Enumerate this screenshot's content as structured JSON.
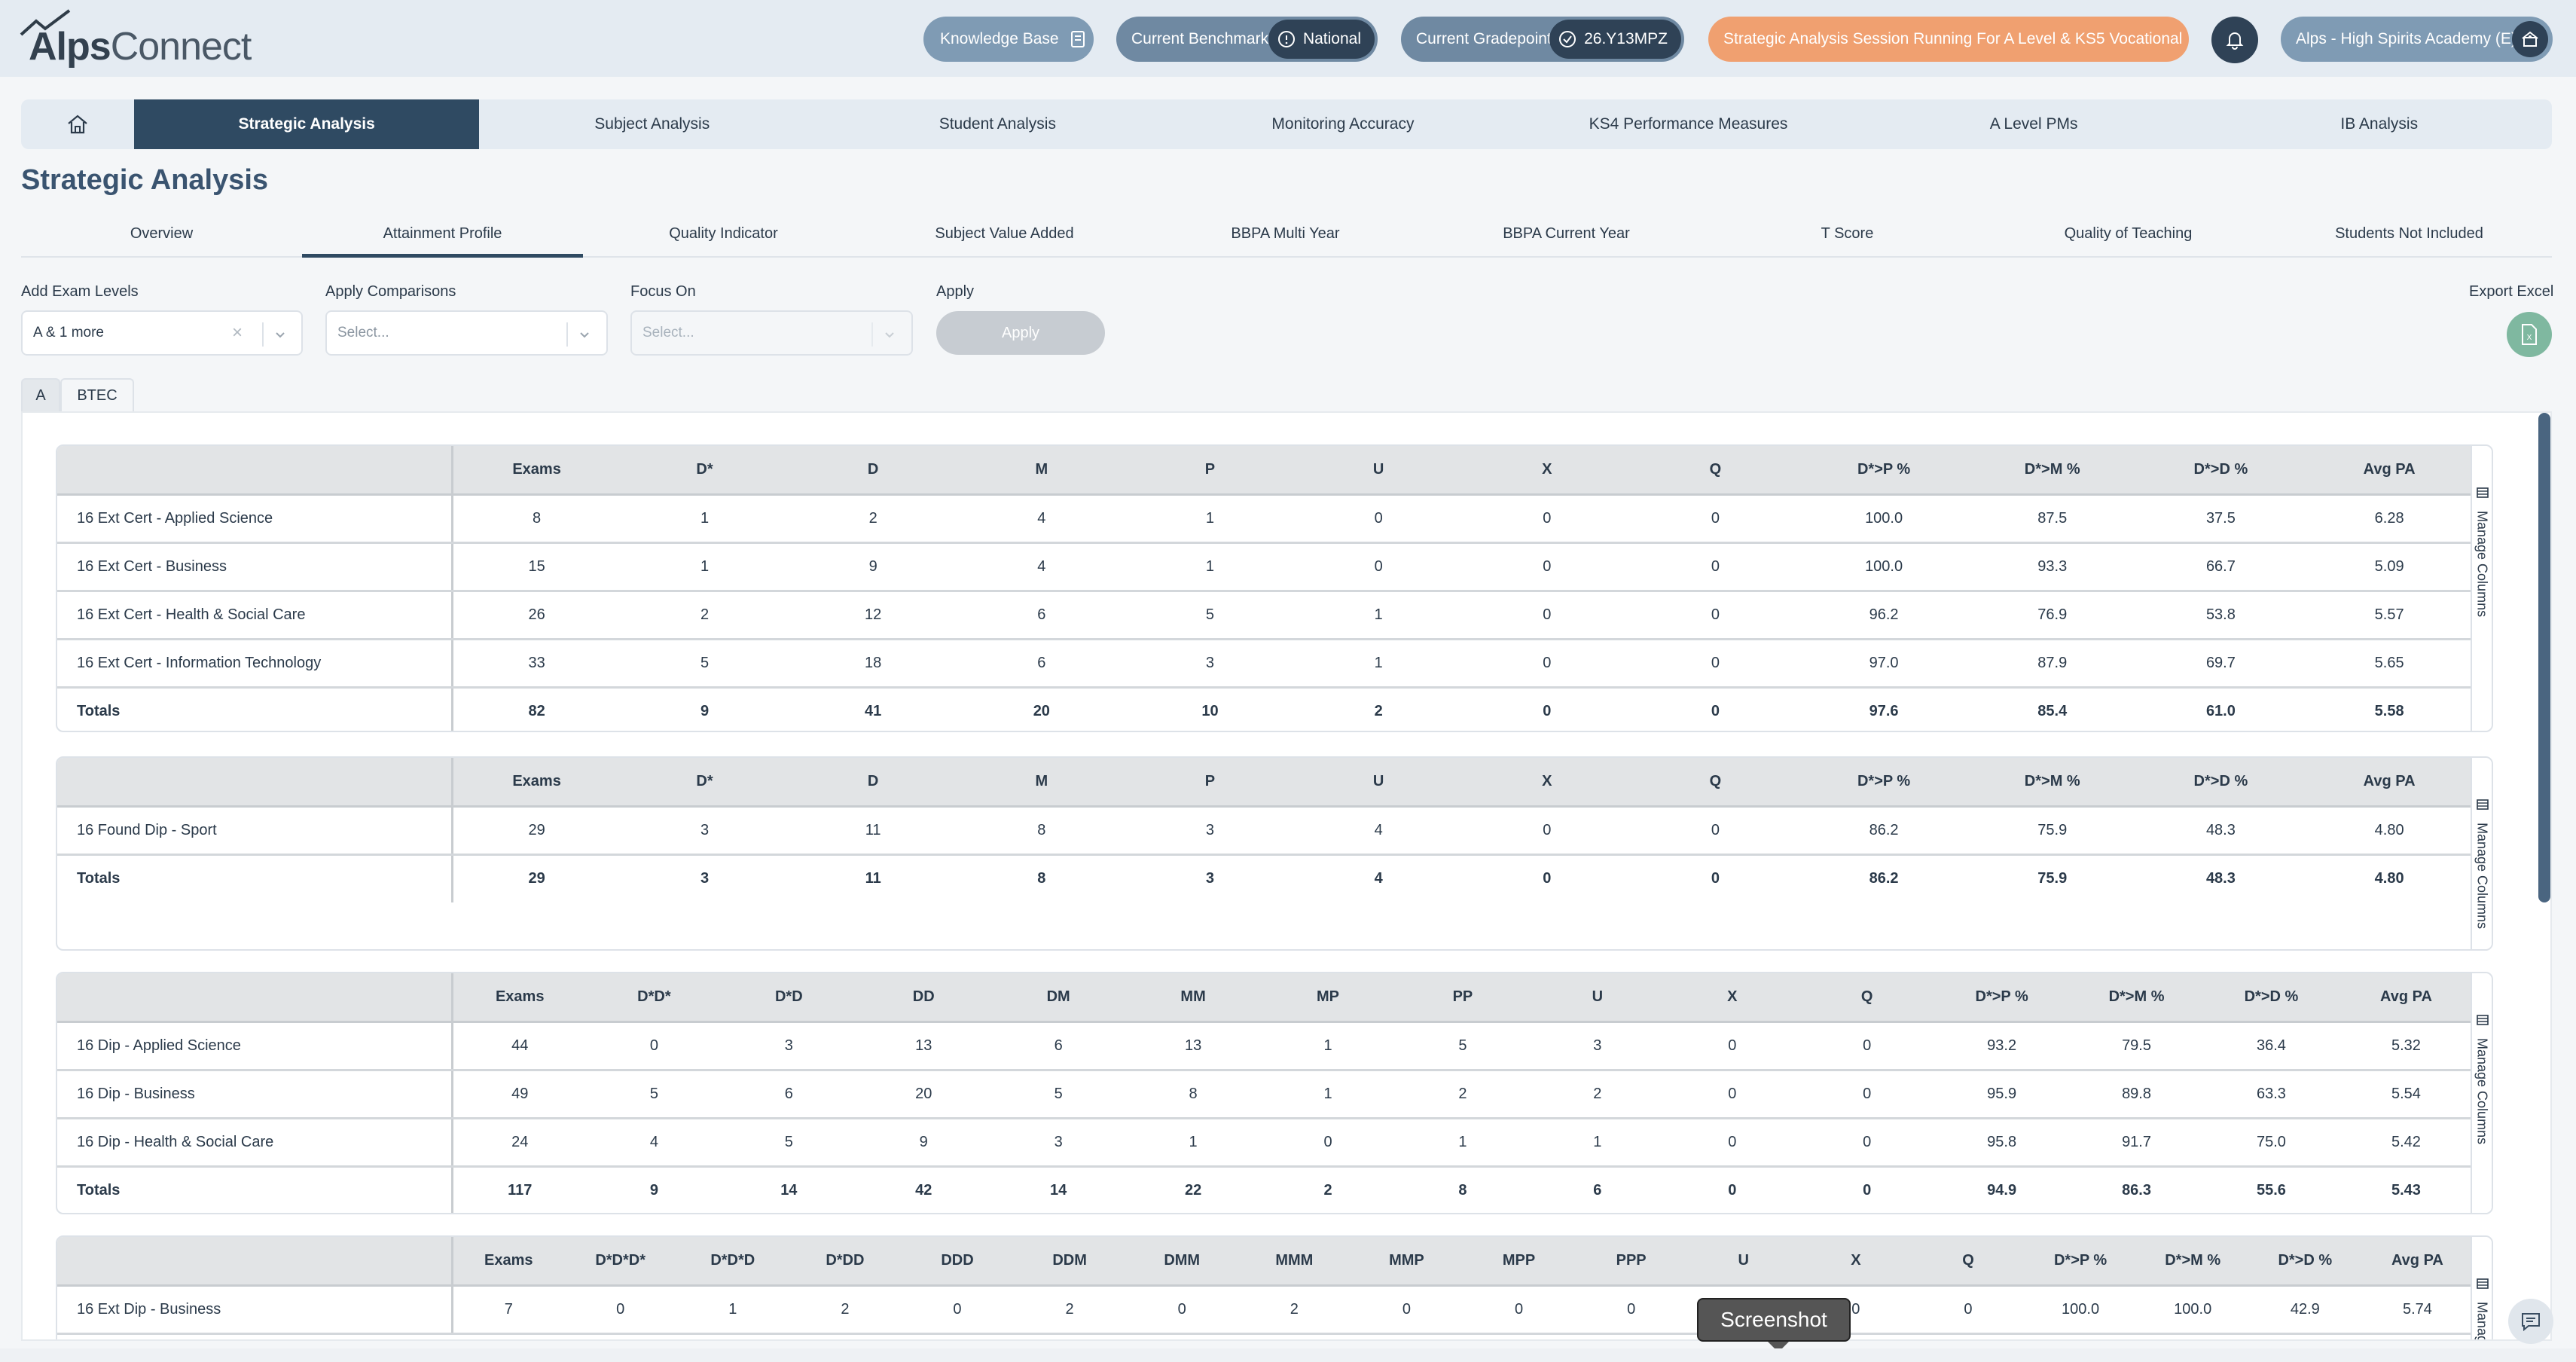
{
  "brand": {
    "logo_bold": "Alps",
    "logo_rest": "Connect"
  },
  "header": {
    "knowledge_base": "Knowledge Base",
    "benchmark_label": "Current Benchmark",
    "benchmark_value": "National",
    "gradepoint_label": "Current Gradepoint",
    "gradepoint_value": "26.Y13MPZ",
    "session": "Strategic Analysis Session Running For A Level & KS5 Vocational",
    "school": "Alps - High Spirits Academy (E)"
  },
  "nav": [
    "Strategic Analysis",
    "Subject Analysis",
    "Student Analysis",
    "Monitoring Accuracy",
    "KS4 Performance Measures",
    "A Level PMs",
    "IB Analysis"
  ],
  "page_title": "Strategic Analysis",
  "subtabs": [
    "Overview",
    "Attainment Profile",
    "Quality Indicator",
    "Subject Value Added",
    "BBPA Multi Year",
    "BBPA Current Year",
    "T Score",
    "Quality of Teaching",
    "Students Not Included"
  ],
  "filters": {
    "exam_levels_label": "Add Exam Levels",
    "exam_levels_value": "A & 1 more",
    "comparisons_label": "Apply Comparisons",
    "comparisons_placeholder": "Select...",
    "focus_label": "Focus On",
    "focus_placeholder": "Select...",
    "apply_label": "Apply",
    "apply_button": "Apply",
    "export_label": "Export Excel"
  },
  "level_tabs": [
    "A",
    "BTEC"
  ],
  "manage_columns": "Manage Columns",
  "tables": [
    {
      "headers": [
        "",
        "Exams",
        "D*",
        "D",
        "M",
        "P",
        "U",
        "X",
        "Q",
        "D*>P %",
        "D*>M %",
        "D*>D %",
        "Avg PA"
      ],
      "rows": [
        [
          "16 Ext Cert - Applied Science",
          "8",
          "1",
          "2",
          "4",
          "1",
          "0",
          "0",
          "0",
          "100.0",
          "87.5",
          "37.5",
          "6.28"
        ],
        [
          "16 Ext Cert - Business",
          "15",
          "1",
          "9",
          "4",
          "1",
          "0",
          "0",
          "0",
          "100.0",
          "93.3",
          "66.7",
          "5.09"
        ],
        [
          "16 Ext Cert - Health & Social Care",
          "26",
          "2",
          "12",
          "6",
          "5",
          "1",
          "0",
          "0",
          "96.2",
          "76.9",
          "53.8",
          "5.57"
        ],
        [
          "16 Ext Cert - Information Technology",
          "33",
          "5",
          "18",
          "6",
          "3",
          "1",
          "0",
          "0",
          "97.0",
          "87.9",
          "69.7",
          "5.65"
        ]
      ],
      "totals": [
        "Totals",
        "82",
        "9",
        "41",
        "20",
        "10",
        "2",
        "0",
        "0",
        "97.6",
        "85.4",
        "61.0",
        "5.58"
      ]
    },
    {
      "headers": [
        "",
        "Exams",
        "D*",
        "D",
        "M",
        "P",
        "U",
        "X",
        "Q",
        "D*>P %",
        "D*>M %",
        "D*>D %",
        "Avg PA"
      ],
      "rows": [
        [
          "16 Found Dip - Sport",
          "29",
          "3",
          "11",
          "8",
          "3",
          "4",
          "0",
          "0",
          "86.2",
          "75.9",
          "48.3",
          "4.80"
        ]
      ],
      "totals": [
        "Totals",
        "29",
        "3",
        "11",
        "8",
        "3",
        "4",
        "0",
        "0",
        "86.2",
        "75.9",
        "48.3",
        "4.80"
      ]
    },
    {
      "headers": [
        "",
        "Exams",
        "D*D*",
        "D*D",
        "DD",
        "DM",
        "MM",
        "MP",
        "PP",
        "U",
        "X",
        "Q",
        "D*>P %",
        "D*>M %",
        "D*>D %",
        "Avg PA"
      ],
      "rows": [
        [
          "16 Dip - Applied Science",
          "44",
          "0",
          "3",
          "13",
          "6",
          "13",
          "1",
          "5",
          "3",
          "0",
          "0",
          "93.2",
          "79.5",
          "36.4",
          "5.32"
        ],
        [
          "16 Dip - Business",
          "49",
          "5",
          "6",
          "20",
          "5",
          "8",
          "1",
          "2",
          "2",
          "0",
          "0",
          "95.9",
          "89.8",
          "63.3",
          "5.54"
        ],
        [
          "16 Dip - Health & Social Care",
          "24",
          "4",
          "5",
          "9",
          "3",
          "1",
          "0",
          "1",
          "1",
          "0",
          "0",
          "95.8",
          "91.7",
          "75.0",
          "5.42"
        ]
      ],
      "totals": [
        "Totals",
        "117",
        "9",
        "14",
        "42",
        "14",
        "22",
        "2",
        "8",
        "6",
        "0",
        "0",
        "94.9",
        "86.3",
        "55.6",
        "5.43"
      ]
    },
    {
      "headers": [
        "",
        "Exams",
        "D*D*D*",
        "D*D*D",
        "D*DD",
        "DDD",
        "DDM",
        "DMM",
        "MMM",
        "MMP",
        "MPP",
        "PPP",
        "U",
        "X",
        "Q",
        "D*>P %",
        "D*>M %",
        "D*>D %",
        "Avg PA"
      ],
      "rows": [
        [
          "16 Ext Dip - Business",
          "7",
          "0",
          "1",
          "2",
          "0",
          "2",
          "0",
          "2",
          "0",
          "0",
          "0",
          "",
          "0",
          "0",
          "100.0",
          "100.0",
          "42.9",
          "5.74"
        ]
      ],
      "totals": null
    }
  ],
  "tooltip": "Screenshot"
}
